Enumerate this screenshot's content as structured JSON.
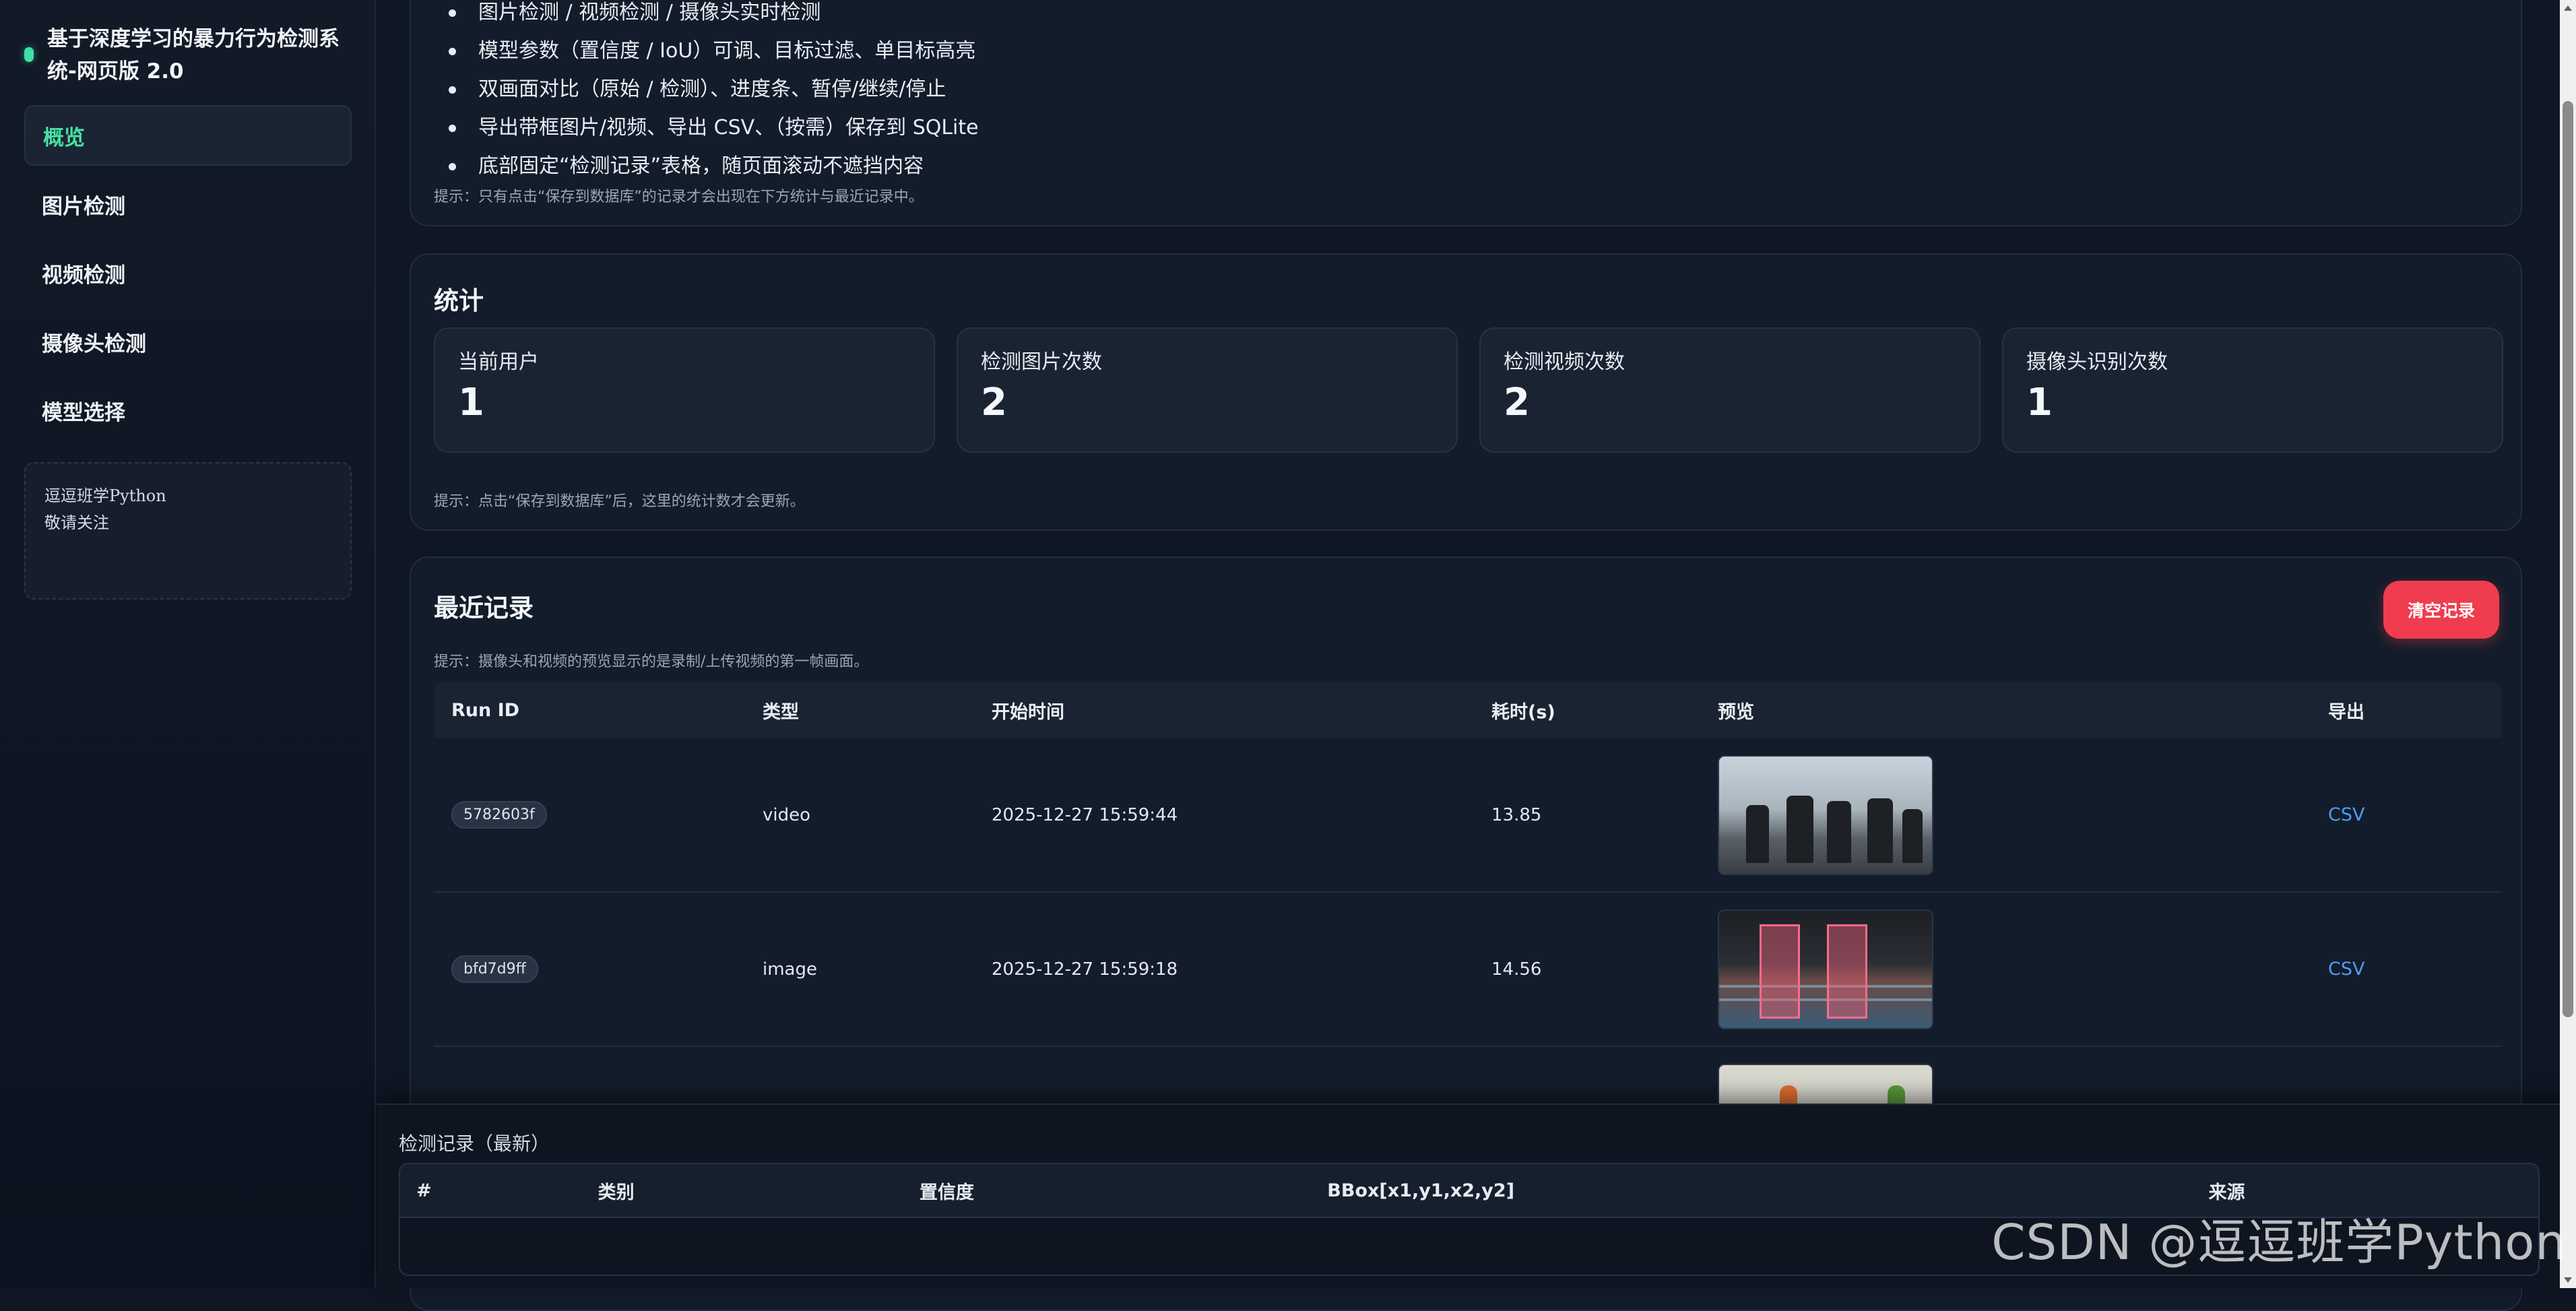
{
  "sidebar": {
    "brand_title": "基于深度学习的暴力行为检测系统-网页版 2.0",
    "nav": [
      {
        "label": "概览",
        "active": true
      },
      {
        "label": "图片检测",
        "active": false
      },
      {
        "label": "视频检测",
        "active": false
      },
      {
        "label": "摄像头检测",
        "active": false
      },
      {
        "label": "模型选择",
        "active": false
      }
    ],
    "note_text": "逗逗班学Python\n敬请关注"
  },
  "intro": {
    "features": [
      "图片检测 / 视频检测 / 摄像头实时检测",
      "模型参数（置信度 / IoU）可调、目标过滤、单目标高亮",
      "双画面对比（原始 / 检测）、进度条、暂停/继续/停止",
      "导出带框图片/视频、导出 CSV、（按需）保存到 SQLite",
      "底部固定“检测记录”表格，随页面滚动不遮挡内容"
    ],
    "tip": "提示：只有点击“保存到数据库”的记录才会出现在下方统计与最近记录中。"
  },
  "stats": {
    "title": "统计",
    "items": [
      {
        "label": "当前用户",
        "value": "1"
      },
      {
        "label": "检测图片次数",
        "value": "2"
      },
      {
        "label": "检测视频次数",
        "value": "2"
      },
      {
        "label": "摄像头识别次数",
        "value": "1"
      }
    ],
    "tip": "提示：点击“保存到数据库”后，这里的统计数才会更新。"
  },
  "recent": {
    "title": "最近记录",
    "clear_label": "清空记录",
    "tip": "提示：摄像头和视频的预览显示的是录制/上传视频的第一帧画面。",
    "columns": [
      "Run ID",
      "类型",
      "开始时间",
      "耗时(s)",
      "预览",
      "导出"
    ],
    "rows": [
      {
        "run_id": "5782603f",
        "type": "video",
        "start": "2025-12-27 15:59:44",
        "duration": "13.85",
        "export": "CSV"
      },
      {
        "run_id": "bfd7d9ff",
        "type": "image",
        "start": "2025-12-27 15:59:18",
        "duration": "14.56",
        "export": "CSV"
      }
    ]
  },
  "detections": {
    "title": "检测记录（最新）",
    "columns": [
      "#",
      "类别",
      "置信度",
      "BBox[x1,y1,x2,y2]",
      "来源"
    ]
  },
  "watermark": "CSDN @逗逗班学Python",
  "colors": {
    "accent": "#48e0a4",
    "danger": "#ef3c4f",
    "link": "#4f9cf5",
    "bg": "#0f1624"
  }
}
